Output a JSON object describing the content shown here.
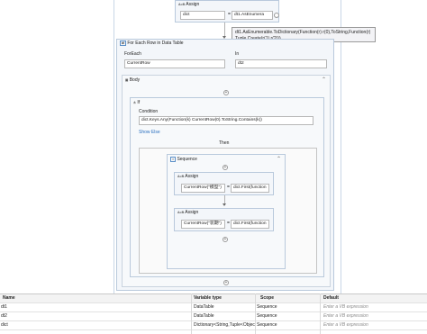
{
  "top_assign": {
    "title": "Assign",
    "to": "dict",
    "value": "dt1.AsEnumera"
  },
  "tooltip": {
    "line1": "dt1.AsEnumerable.ToDictionary(Function(r) r(0),ToString,Function(r)",
    "line2": "Tuple.Create(r(1),r(2)))"
  },
  "foreach": {
    "title": "For Each Row in Data Table",
    "foreach_label": "ForEach",
    "in_label": "In",
    "foreach_value": "CurrentRow",
    "in_value": "dt2"
  },
  "body": {
    "title": "Body"
  },
  "if": {
    "title": "If",
    "condition_label": "Condition",
    "condition_value": "dict.Keys.Any(Function(k) CurrentRow(0).ToString.Contains(k))",
    "show_else": "Show Else",
    "then_label": "Then"
  },
  "sequence": {
    "title": "Sequence"
  },
  "assign1": {
    "title": "Assign",
    "to": "CurrentRow(\"模型\")",
    "value": "dict.First(function"
  },
  "assign2": {
    "title": "Assign",
    "to": "CurrentRow(\"装期\")",
    "value": "dict.First(function"
  },
  "variables": {
    "headers": [
      "Name",
      "Variable type",
      "Scope",
      "Default"
    ],
    "rows": [
      [
        "dt1",
        "DataTable",
        "Sequence",
        "Enter a VB expression"
      ],
      [
        "dt2",
        "DataTable",
        "Sequence",
        "Enter a VB expression"
      ],
      [
        "dict",
        "Dictionary<String,Tuple<Objec",
        "Sequence",
        "Enter a VB expression"
      ]
    ]
  },
  "colors": {
    "activity_border": "#b9c9dc",
    "activity_bg": "#f3f6fa",
    "link": "#2a6fbf"
  },
  "icons": [
    "assign-icon",
    "foreach-icon",
    "body-icon",
    "if-icon",
    "sequence-icon",
    "plus-icon",
    "collapse-icon"
  ]
}
